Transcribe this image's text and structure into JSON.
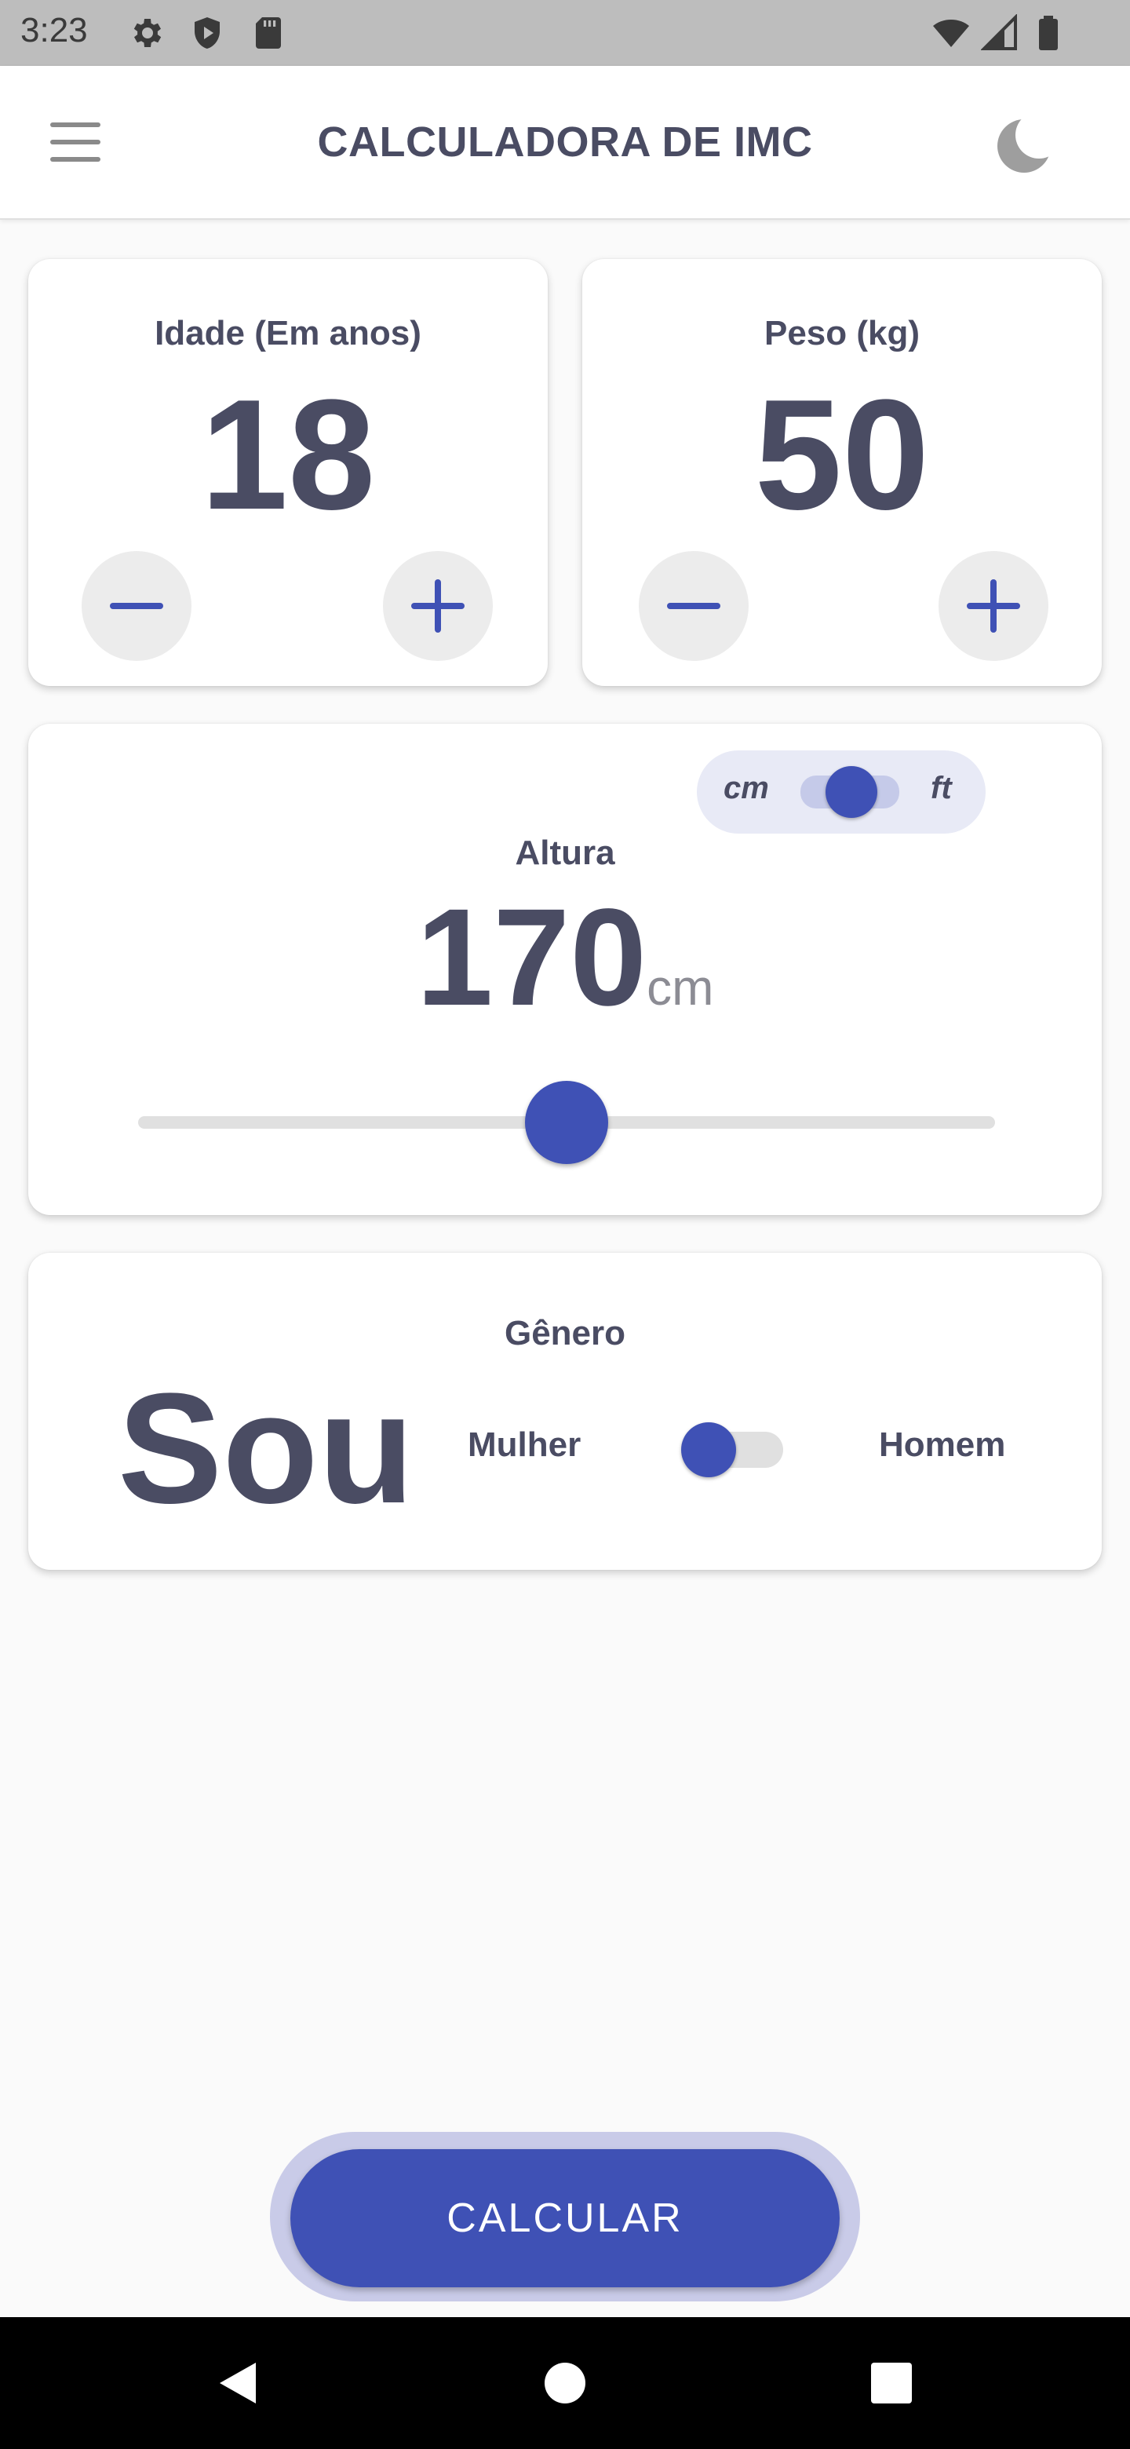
{
  "status_bar": {
    "time": "3:23",
    "left_icons": [
      "gear-icon",
      "shield-icon",
      "sd-card-icon"
    ],
    "right_icons": [
      "wifi-icon",
      "signal-icon",
      "battery-icon"
    ]
  },
  "app_bar": {
    "title": "CALCULADORA DE IMC",
    "menu_icon": "menu-icon",
    "theme_icon": "moon-icon"
  },
  "age_card": {
    "label": "Idade (Em anos)",
    "value": "18"
  },
  "weight_card": {
    "label": "Peso (kg)",
    "value": "50"
  },
  "height_card": {
    "unit_left": "cm",
    "unit_right": "ft",
    "unit_toggle_selected": "cm",
    "label": "Altura",
    "value": "170",
    "unit": "cm",
    "slider_fraction": 0.5
  },
  "gender_card": {
    "label": "Gênero",
    "big_text": "Sou",
    "female_label": "Mulher",
    "male_label": "Homem",
    "selected": "Mulher"
  },
  "calculate_button": {
    "label": "CALCULAR"
  },
  "colors": {
    "primary": "#3f51b5",
    "text": "#4a4c63",
    "muted": "#8c8c94",
    "background": "#fafafa",
    "status_bar": "#bdbdbd",
    "nav_bar": "#000000"
  },
  "nav_bar": {
    "icons": [
      "back-icon",
      "home-icon",
      "recents-icon"
    ]
  }
}
